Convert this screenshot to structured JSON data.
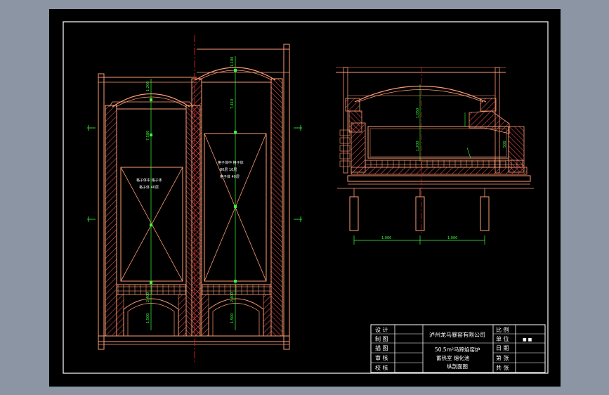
{
  "app": {
    "canvas_background": "#8c95a3",
    "sheet_background": "#000000"
  },
  "colors": {
    "frame": "#ffffff",
    "brick": "#ff9b73",
    "hatch": "#ff5a5a",
    "center_line": "#ff2020",
    "dimension": "#39ff39",
    "dim_leader": "#ffffff",
    "title_text": "#ffffff"
  },
  "title_block": {
    "labels": {
      "design": "设 计",
      "draw": "制 图",
      "trace": "描 图",
      "review": "审 核",
      "check": "校 核"
    },
    "company": "泸州龙马暴窑有限公司",
    "drawing_title_line1": "50.5m²马蹄焰窑炉",
    "drawing_title_line2": "蓄热室  熔化池",
    "drawing_title_line3": "纵剖面图",
    "right_labels": {
      "scale": "比 例",
      "unit": "单 位",
      "date": "日 期",
      "sheet_no": "第 张",
      "total": "共 张"
    },
    "unit_value": "■ ■"
  },
  "left_view": {
    "chamber_left_note": [
      "格子体中 格子体",
      "格子体 40层"
    ],
    "chamber_right_note": [
      "格子体中 格子体",
      "80层 10层",
      "格子体 40层"
    ],
    "dims_vertical": [
      "1,200",
      "7,580",
      "2,400",
      "1,500"
    ],
    "dims_vertical_right": [
      "1,100",
      "7,410",
      "2,400",
      "1,500"
    ]
  },
  "right_view": {
    "dim_left": "1,000",
    "dim_right": "1,000",
    "dims_vertical": [
      "1,050",
      "1,200",
      "500"
    ]
  }
}
